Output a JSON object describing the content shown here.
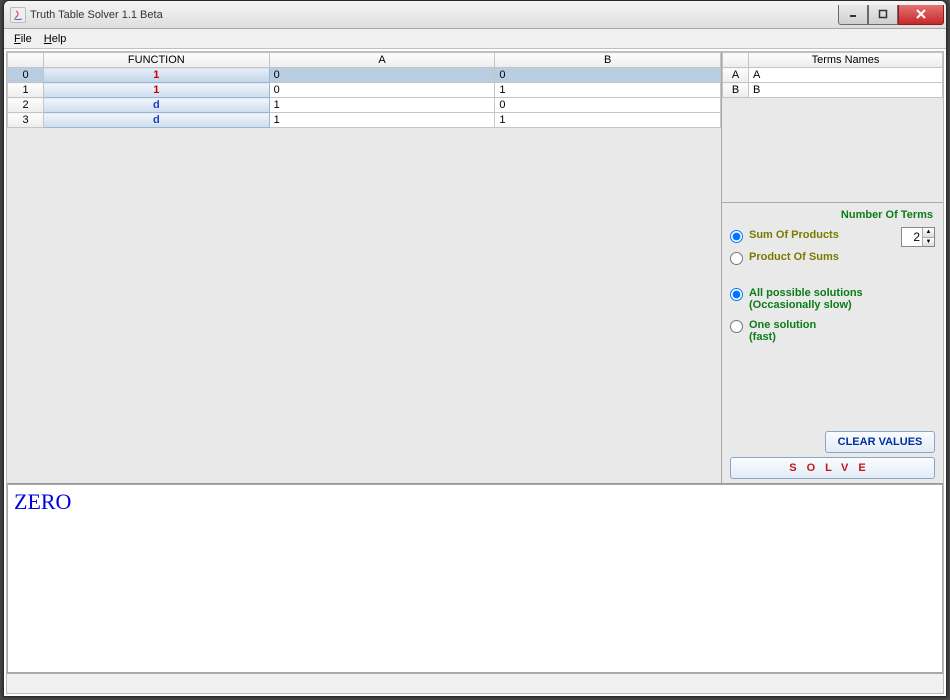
{
  "window": {
    "title": "Truth Table Solver 1.1 Beta"
  },
  "menu": {
    "file": "File",
    "help": "Help"
  },
  "truth_table": {
    "headers": [
      "FUNCTION",
      "A",
      "B"
    ],
    "rows": [
      {
        "idx": "0",
        "func": "1",
        "func_class": "",
        "a": "0",
        "b": "0",
        "selected": true
      },
      {
        "idx": "1",
        "func": "1",
        "func_class": "",
        "a": "0",
        "b": "1",
        "selected": false
      },
      {
        "idx": "2",
        "func": "d",
        "func_class": "d",
        "a": "1",
        "b": "0",
        "selected": false
      },
      {
        "idx": "3",
        "func": "d",
        "func_class": "d",
        "a": "1",
        "b": "1",
        "selected": false
      }
    ]
  },
  "terms_table": {
    "header": "Terms Names",
    "rows": [
      {
        "key": "A",
        "val": "A"
      },
      {
        "key": "B",
        "val": "B"
      }
    ]
  },
  "options": {
    "num_terms_label": "Number Of Terms",
    "num_terms_value": "2",
    "form": {
      "sop": "Sum Of Products",
      "pos": "Product Of Sums"
    },
    "solutions": {
      "all": "All possible solutions\n(Occasionally slow)",
      "one": "One solution\n(fast)"
    },
    "clear_label": "CLEAR VALUES",
    "solve_label": "SOLVE"
  },
  "output": "ZERO"
}
